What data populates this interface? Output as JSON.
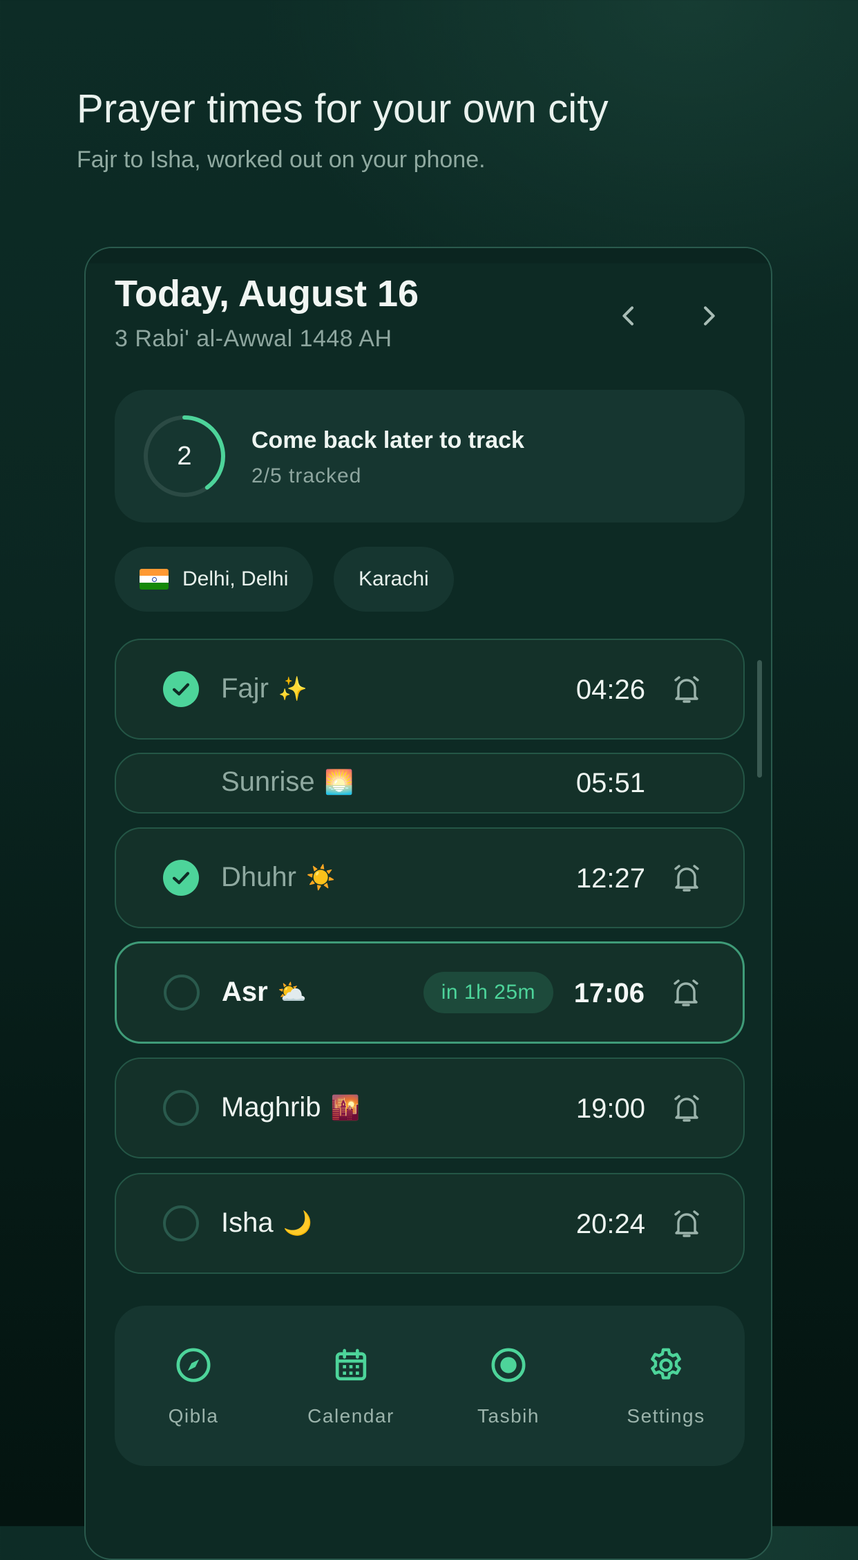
{
  "hero": {
    "title": "Prayer times for your own city",
    "subtitle": "Fajr to Isha, worked out on your phone."
  },
  "date_header": {
    "title": "Today, August 16",
    "hijri": "3 Rabi' al-Awwal 1448 AH",
    "prev_icon": "chevron-left-icon",
    "next_icon": "chevron-right-icon"
  },
  "tracker": {
    "count": "2",
    "title": "Come back later to track",
    "subtitle": "2/5 tracked",
    "progress_fraction": 0.4,
    "accent_color": "#4dd49a"
  },
  "locations": [
    {
      "label": "Delhi, Delhi",
      "icon": "india-flag-icon"
    },
    {
      "label": "Karachi"
    }
  ],
  "prayers": [
    {
      "name": "Fajr",
      "emoji": "✨",
      "time": "04:26",
      "status": "done",
      "alarm_icon": "alarm-bell-icon"
    },
    {
      "name": "Sunrise",
      "emoji": "🌅",
      "time": "05:51",
      "status": "info"
    },
    {
      "name": "Dhuhr",
      "emoji": "☀️",
      "time": "12:27",
      "status": "done",
      "alarm_icon": "alarm-bell-icon"
    },
    {
      "name": "Asr",
      "emoji": "⛅",
      "time": "17:06",
      "status": "next",
      "countdown": "in 1h 25m",
      "alarm_icon": "alarm-bell-icon"
    },
    {
      "name": "Maghrib",
      "emoji": "🌇",
      "time": "19:00",
      "status": "upcoming",
      "alarm_icon": "alarm-bell-icon"
    },
    {
      "name": "Isha",
      "emoji": "🌙",
      "time": "20:24",
      "status": "upcoming",
      "alarm_icon": "alarm-bell-icon"
    }
  ],
  "bottom_nav": [
    {
      "label": "Qibla",
      "icon": "compass-icon"
    },
    {
      "label": "Calendar",
      "icon": "calendar-icon"
    },
    {
      "label": "Tasbih",
      "icon": "tasbih-icon"
    },
    {
      "label": "Settings",
      "icon": "gear-icon"
    }
  ],
  "colors": {
    "background": "#0b2621",
    "card": "#163630",
    "accent": "#4dd49a",
    "muted_text": "#8ea69f"
  }
}
